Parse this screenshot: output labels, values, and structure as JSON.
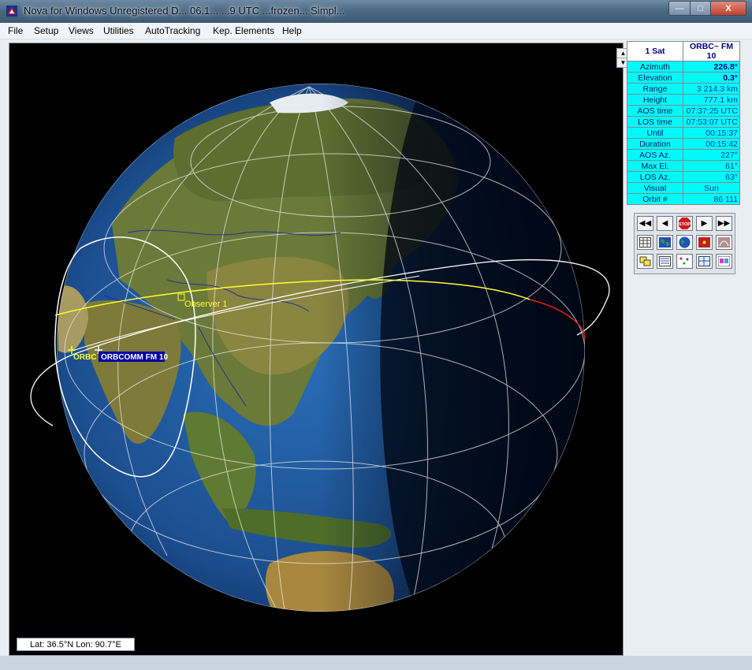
{
  "window": {
    "title": "Nova for Windows  Unregistered D...  06.1...  ...9 UTC  ...frozen...  Simpl...",
    "min_label": "—",
    "max_label": "□",
    "close_label": "X"
  },
  "menu": {
    "items": [
      "File",
      "Setup",
      "Views",
      "Utilities",
      "AutoTracking",
      "Kep. Elements",
      "Help"
    ]
  },
  "globe": {
    "observer_label": "Observer 1",
    "sat_label": "ORBCOMM FM 10",
    "sat_label2": "ORBC",
    "status": "Lat: 36.5°N  Lon:  90.7°E"
  },
  "panel": {
    "header_left": "1 Sat",
    "header_right": "ORBC~ FM 10",
    "rows": [
      {
        "label": "Azimuth",
        "value": "226.8°",
        "bold": true
      },
      {
        "label": "Elevation",
        "value": "0.3°",
        "bold": true
      },
      {
        "label": "Range",
        "value": "3 214.3 km"
      },
      {
        "label": "Height",
        "value": "777.1 km"
      },
      {
        "label": "AOS time",
        "value": "07:37:25 UTC"
      },
      {
        "label": "LOS time",
        "value": "07:53:07 UTC"
      },
      {
        "label": "Until",
        "value": "00:15:37"
      },
      {
        "label": "Duration",
        "value": "00:15:42"
      },
      {
        "label": "AOS Az.",
        "value": "227°"
      },
      {
        "label": "Max El.",
        "value": "61°"
      },
      {
        "label": "LOS Az.",
        "value": "63°"
      },
      {
        "label": "Visual",
        "value": "Sun"
      },
      {
        "label": "Orbit #",
        "value": "86 111"
      }
    ]
  },
  "toolbar": {
    "buttons_row1": [
      "rewind-icon",
      "step-back-icon",
      "stop-icon",
      "play-icon",
      "fast-forward-icon"
    ],
    "buttons_row2": [
      "table-icon",
      "map-icon",
      "globe-icon",
      "radar-icon",
      "sky-icon"
    ],
    "buttons_row3": [
      "windows-icon",
      "list-icon",
      "satellite-icon",
      "grid-icon",
      "color-icon"
    ],
    "stop_label": "STOP"
  }
}
